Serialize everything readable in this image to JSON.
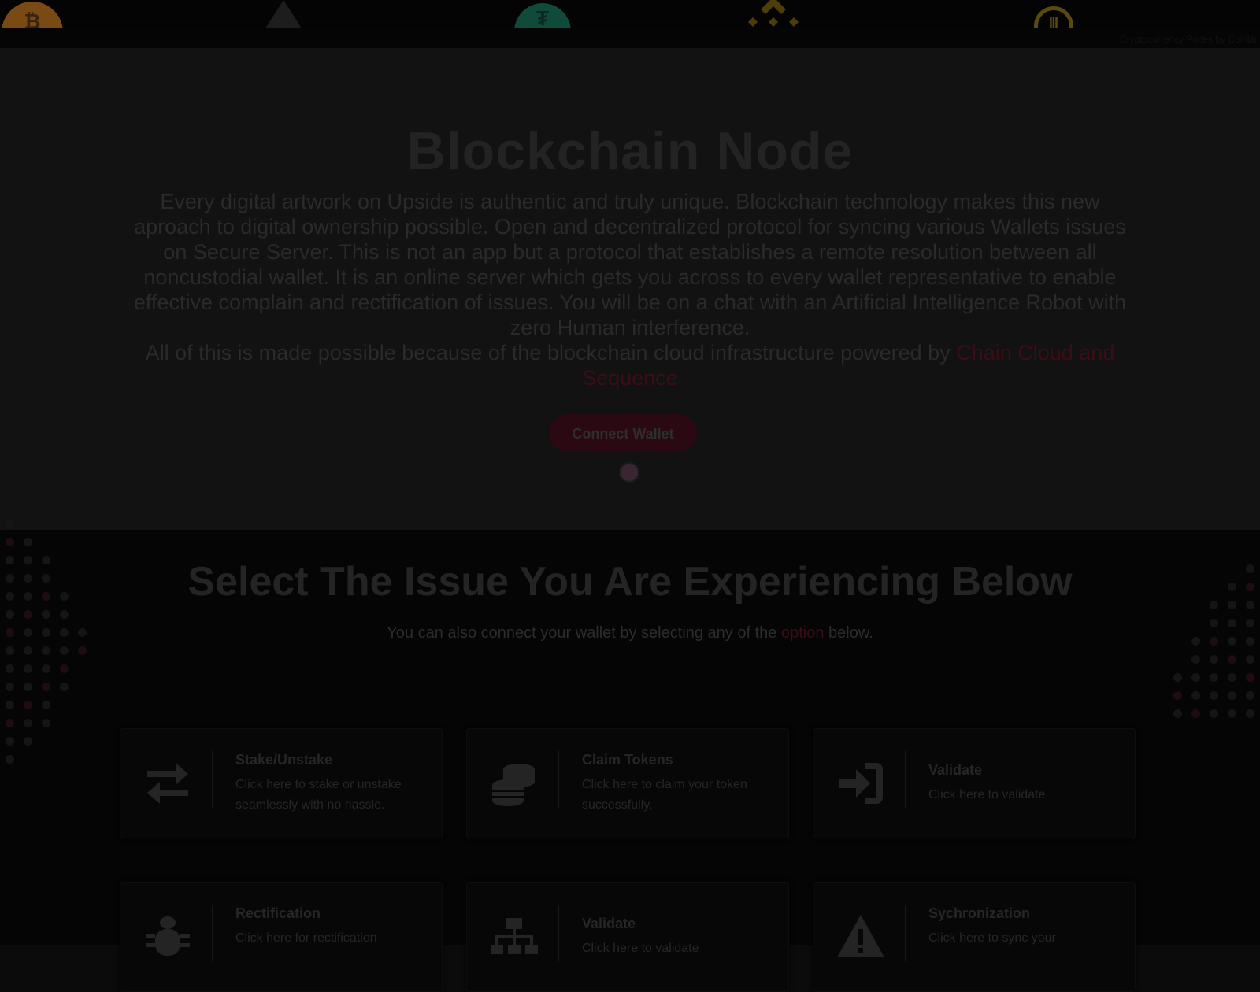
{
  "ticker": {
    "coins": [
      {
        "name": "bitcoin-logo",
        "glyph": "₿",
        "color": "#7a4a14"
      },
      {
        "name": "triangle-coin-logo",
        "glyph": "",
        "color": "#1d1d1d"
      },
      {
        "name": "tether-logo",
        "glyph": "₮",
        "color": "#0f4a3a"
      },
      {
        "name": "binance-logo",
        "glyph": "",
        "color": "#4d3d0a"
      },
      {
        "name": "algorand-logo",
        "glyph": "Ⅲ",
        "color": "#5a4a12"
      }
    ],
    "credit": "Cryptocurrency Prices by Coinlib"
  },
  "hero": {
    "title": "Blockchain Node",
    "paragraph": "Every digital artwork on Upside is authentic and truly unique. Blockchain technology makes this new aproach to digital ownership possible. Open and decentralized protocol for syncing various Wallets issues on Secure Server. This is not an app but a protocol that establishes a remote resolution between all noncustodial wallet. It is an online server which gets you across to every wallet representative to enable effective complain and rectification of issues. You will be on a chat with an Artificial Intelligence Robot with zero Human interference.",
    "powered_prefix": "All of this is made possible because of the blockchain cloud infrastructure powered by ",
    "powered_link": "Chain Cloud and Sequence",
    "connect_label": "Connect Wallet"
  },
  "issues": {
    "title": "Select The Issue You Are Experiencing Below",
    "sub_prefix": "You can also connect your wallet by selecting any of the ",
    "sub_link": "option",
    "sub_suffix": " below.",
    "cards": [
      {
        "title": "Stake/Unstake",
        "desc": "Click here to stake or unstake seamlessly with no hassle.",
        "icon": "exchange-arrows-icon"
      },
      {
        "title": "Claim Tokens",
        "desc": "Click here to claim your token successfully.",
        "icon": "coins-stack-icon"
      },
      {
        "title": "Validate",
        "desc": "Click here to validate",
        "icon": "sign-in-icon"
      },
      {
        "title": "Rectification",
        "desc": "Click here for rectification",
        "icon": "bug-icon"
      },
      {
        "title": "Validate",
        "desc": "Click here to validate",
        "icon": "network-icon"
      },
      {
        "title": "Sychronization",
        "desc": "Click here to sync your",
        "icon": "warning-icon"
      }
    ]
  },
  "colors": {
    "accent": "#3d0d17",
    "hero_bg": "#121212",
    "issues_bg": "#050505"
  }
}
